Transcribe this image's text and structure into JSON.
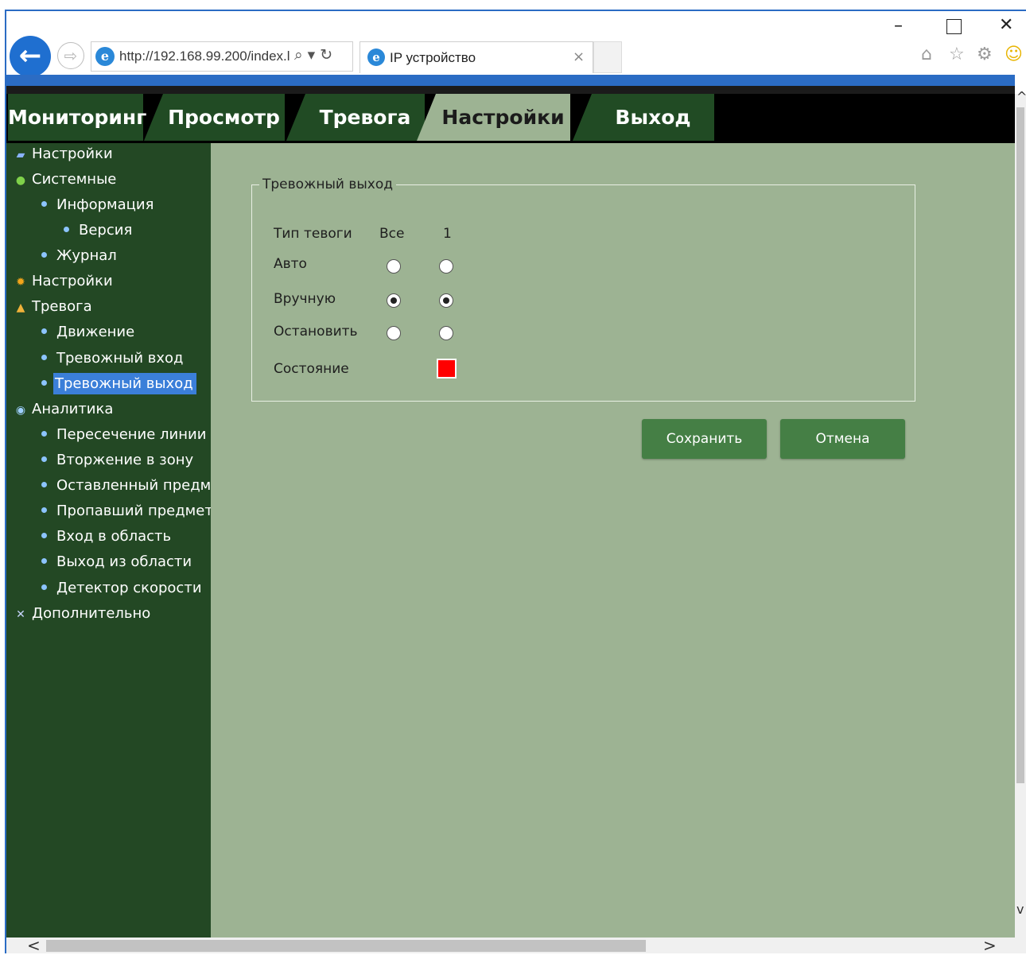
{
  "browser": {
    "address": "http://192.168.99.200/index.l",
    "tab_title": "IP устройство",
    "back_glyph": "←",
    "forward_glyph": "⇨",
    "ie_glyph": "e",
    "search_glyph": "⌕",
    "dropdown_glyph": "▾",
    "refresh_glyph": "↻",
    "close_glyph": "×",
    "min_glyph": "–",
    "win_close_glyph": "✕",
    "home_glyph": "⌂",
    "star_glyph": "☆",
    "gear_glyph": "⚙",
    "smiley_glyph": "☺",
    "colors": {
      "accent": "#2b6cc4"
    }
  },
  "nav": {
    "tabs": [
      {
        "label": "Мониторинг"
      },
      {
        "label": "Просмотр"
      },
      {
        "label": "Тревога"
      },
      {
        "label": "Настройки"
      },
      {
        "label": "Выход"
      }
    ],
    "active": "Настройки",
    "colors": {
      "tab_bg": "#214b24",
      "active_bg": "#9db393"
    }
  },
  "sidebar": {
    "items": [
      {
        "label": "Настройки",
        "icon": "▰"
      },
      {
        "label": "Системные",
        "icon": "●"
      },
      {
        "label": "Информация"
      },
      {
        "label": "Версия"
      },
      {
        "label": "Журнал"
      },
      {
        "label": "Настройки",
        "icon": "✹"
      },
      {
        "label": "Тревога",
        "icon": "▲"
      },
      {
        "label": "Движение"
      },
      {
        "label": "Тревожный вход"
      },
      {
        "label": "Тревожный выход"
      },
      {
        "label": "Аналитика",
        "icon": "◉"
      },
      {
        "label": "Пересечение линии"
      },
      {
        "label": "Вторжение в зону"
      },
      {
        "label": "Оставленный предме"
      },
      {
        "label": "Пропавший предмет"
      },
      {
        "label": "Вход в область"
      },
      {
        "label": "Выход из области"
      },
      {
        "label": "Детектор скорости"
      },
      {
        "label": "Дополнительно",
        "icon": "✕"
      }
    ],
    "selected": "Тревожный выход",
    "colors": {
      "bg": "#234824",
      "selected_bg": "#3b7fd9"
    }
  },
  "form": {
    "legend": "Тревожный выход",
    "header_type": "Тип тевоги",
    "header_all": "Все",
    "header_one": "1",
    "rows": [
      {
        "label": "Авто",
        "all": false,
        "one": false
      },
      {
        "label": "Вручную",
        "all": true,
        "one": true
      },
      {
        "label": "Остановить",
        "all": false,
        "one": false
      }
    ],
    "state_label": "Состояние",
    "state_color": "#ff0000",
    "save": "Сохранить",
    "cancel": "Отмена"
  },
  "scroll": {
    "left_glyph": "<",
    "right_glyph": ">",
    "up_glyph": "^",
    "down_glyph": "v"
  }
}
